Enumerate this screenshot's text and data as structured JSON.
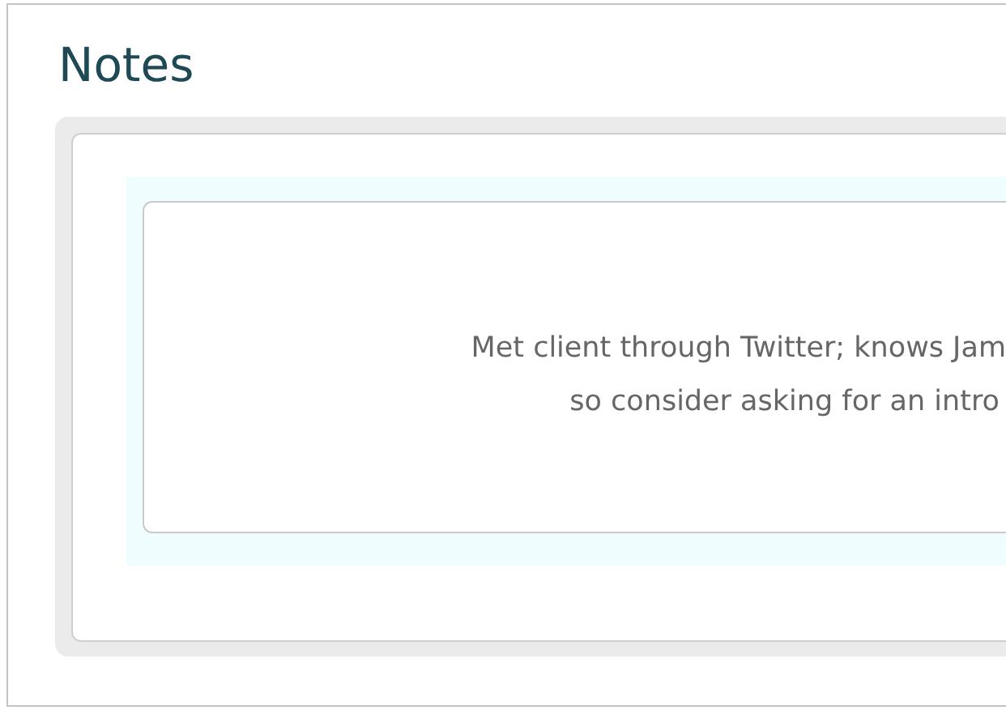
{
  "section": {
    "title": "Notes"
  },
  "note": {
    "lines": [
      "Met client through Twitter; knows Jam",
      "so consider asking for an intro"
    ]
  }
}
